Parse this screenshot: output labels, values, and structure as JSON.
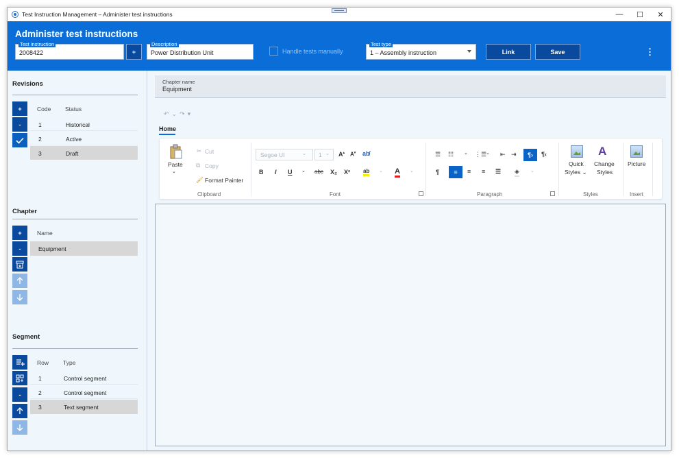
{
  "window": {
    "title": "Test Instruction Management – Administer test instructions",
    "controls": {
      "minimize": "—",
      "maximize": "☐",
      "close": "✕"
    }
  },
  "header": {
    "title": "Administer test instructions",
    "test_instruction": {
      "label": "Test instruction",
      "value": "2008422"
    },
    "add_button": "+",
    "description": {
      "label": "Description",
      "value": "Power Distribution Unit"
    },
    "handle_manually": {
      "label": "Handle tests manually",
      "checked": false
    },
    "test_type": {
      "label": "Test type",
      "value": "1 – Assembly instruction"
    },
    "link_button": "Link",
    "save_button": "Save",
    "more_icon": "⋮"
  },
  "revisions": {
    "title": "Revisions",
    "add": "+",
    "remove": "-",
    "columns": [
      "Code",
      "Status"
    ],
    "rows": [
      {
        "code": "1",
        "status": "Historical"
      },
      {
        "code": "2",
        "status": "Active"
      },
      {
        "code": "3",
        "status": "Draft"
      }
    ]
  },
  "chapter": {
    "title": "Chapter",
    "add": "+",
    "remove": "-",
    "columns": [
      "Name"
    ],
    "rows": [
      {
        "name": "Equipment"
      }
    ]
  },
  "segment": {
    "title": "Segment",
    "remove": "-",
    "columns": [
      "Row",
      "Type"
    ],
    "rows": [
      {
        "row": "1",
        "type": "Control segment"
      },
      {
        "row": "2",
        "type": "Control segment"
      },
      {
        "row": "3",
        "type": "Text segment"
      }
    ]
  },
  "chapter_name": {
    "label": "Chapter name",
    "value": "Equipment"
  },
  "ribbon": {
    "tab": "Home",
    "clipboard": {
      "label": "Clipboard",
      "paste": "Paste",
      "cut": "Cut",
      "copy": "Copy",
      "format_painter": "Format Painter"
    },
    "font": {
      "label": "Font",
      "family": "Segoe UI",
      "size": "1",
      "bold": "B",
      "italic": "I",
      "underline": "U",
      "strike": "abc",
      "sub": "X₂",
      "sup": "X²"
    },
    "paragraph": {
      "label": "Paragraph"
    },
    "styles": {
      "label": "Styles",
      "quick_1": "Quick",
      "quick_2": "Styles ⌄",
      "change_1": "Change",
      "change_2": "Styles"
    },
    "insert": {
      "label": "Insert",
      "picture": "Picture"
    }
  }
}
